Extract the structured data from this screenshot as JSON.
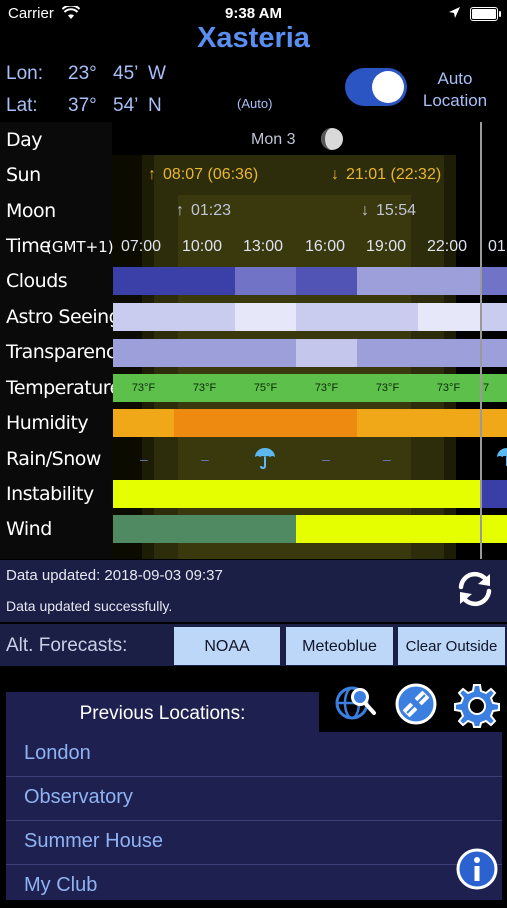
{
  "status": {
    "carrier": "Carrier",
    "time": "9:38 AM"
  },
  "app": {
    "title": "Xasteria"
  },
  "location": {
    "lon_label": "Lon:",
    "lon_deg": "23°",
    "lon_min": "45’",
    "lon_dir": "W",
    "lat_label": "Lat:",
    "lat_deg": "37°",
    "lat_min": "54’",
    "lat_dir": "N",
    "auto_tag": "(Auto)",
    "auto_location_label": "Auto Location",
    "auto_location_on": true
  },
  "forecast": {
    "row_labels": {
      "day": "Day",
      "sun": "Sun",
      "moon": "Moon",
      "time": "Time",
      "time_zone": "(GMT+1)",
      "clouds": "Clouds",
      "astro_seeing": "Astro Seeing",
      "transparency": "Transparency",
      "temperature": "Temperature",
      "humidity": "Humidity",
      "rain_snow": "Rain/Snow",
      "instability": "Instability",
      "wind": "Wind"
    },
    "day_value": "Mon 3",
    "sunrise": "08:07 (06:36)",
    "sunset": "21:01 (22:32)",
    "moonrise": "01:23",
    "moonset": "15:54",
    "times": [
      "07:00",
      "10:00",
      "13:00",
      "16:00",
      "19:00",
      "22:00",
      "01"
    ],
    "temperatures": [
      "73°F",
      "73°F",
      "75°F",
      "73°F",
      "73°F",
      "73°F",
      "7"
    ],
    "colors": {
      "clouds_dark": "#3b3fa8",
      "sunlight": "#e8b630",
      "instability": "#e6ff00",
      "wind_green": "#4f8a63"
    }
  },
  "updates": {
    "last_updated": "Data updated: 2018-09-03 09:37",
    "status_message": "Data updated successfully."
  },
  "alt_forecasts": {
    "label": "Alt. Forecasts:",
    "buttons": [
      "NOAA",
      "Meteoblue",
      "Clear Outside"
    ]
  },
  "previous_locations": {
    "header": "Previous Locations:",
    "items": [
      "London",
      "Observatory",
      "Summer House",
      "My Club"
    ]
  },
  "icons": [
    "wifi-icon",
    "location-arrow-icon",
    "battery-icon",
    "moon-phase-icon",
    "umbrella-icon",
    "refresh-icon",
    "globe-search-icon",
    "satellite-icon",
    "gear-icon",
    "info-icon"
  ]
}
